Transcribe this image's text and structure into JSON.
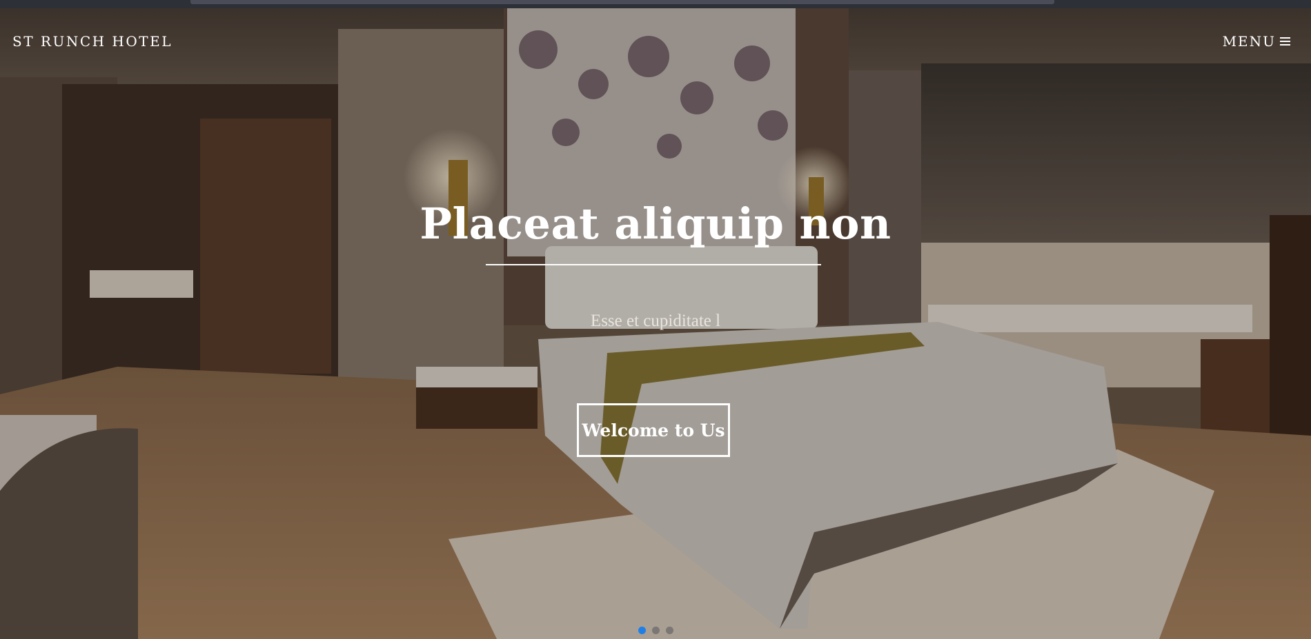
{
  "header": {
    "brand": "ST RUNCH HOTEL",
    "menu_label": "MENU",
    "menu_icon": "hamburger-icon"
  },
  "hero": {
    "title": "Placeat aliquip non",
    "subtitle": "Esse et cupiditate l",
    "cta_label": "Welcome to Us",
    "background": "hotel room photo"
  },
  "carousel": {
    "slide_count": 3,
    "active_index": 0
  },
  "colors": {
    "text": "#ffffff",
    "active_dot": "#1f7fe8",
    "inactive_dot": "#7a7775"
  }
}
